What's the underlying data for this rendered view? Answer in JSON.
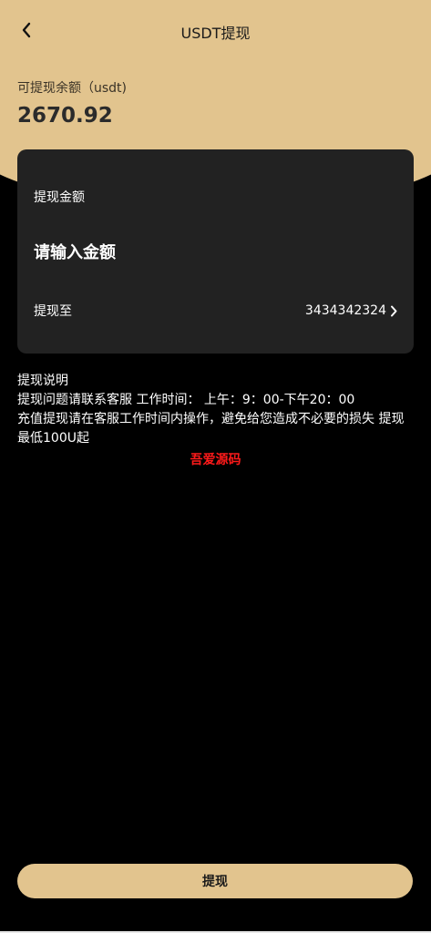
{
  "header": {
    "title": "USDT提现",
    "back_icon": "chevron-left-icon"
  },
  "balance": {
    "label": "可提现余额（usdt)",
    "value": "2670.92"
  },
  "form": {
    "amount_label": "提现金额",
    "amount_placeholder": "请输入金额",
    "amount_value": "",
    "to_label": "提现至",
    "to_value": "3434342324",
    "to_icon": "chevron-right-icon"
  },
  "notes": {
    "title": "提现说明",
    "line1": "提现问题请联系客服 工作时间： 上午：9：00-下午20：00",
    "line2": "充值提现请在客服工作时间内操作，避免给您造成不必要的损失 提现最低100U起"
  },
  "watermark": "吾爱源码",
  "submit_label": "提现",
  "colors": {
    "accent": "#e2c48e",
    "background": "#000000",
    "card": "#222222",
    "watermark": "#ff1a1a"
  }
}
